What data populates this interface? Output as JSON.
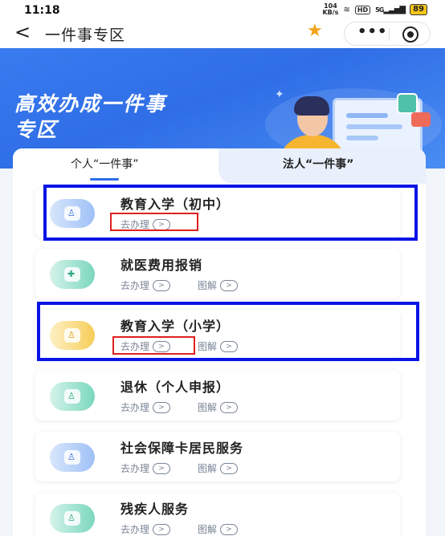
{
  "status_bar": {
    "time": "11:18",
    "net_speed_top": "104",
    "net_speed_bottom": "KB/s",
    "signal": "5G",
    "battery": "89"
  },
  "nav": {
    "back_glyph": "<",
    "title": "一件事专区",
    "more_glyph": "•••"
  },
  "banner": {
    "title_line1": "高效办成一件事",
    "title_line2": "专区"
  },
  "tabs": [
    {
      "label": "个人“一件事”",
      "active": true
    },
    {
      "label": "法人“一件事”",
      "active": false
    }
  ],
  "items": [
    {
      "name": "教育入学（初中）",
      "action": "去办理",
      "icon": "education-icon",
      "icon_color": "blue",
      "highlighted": true
    },
    {
      "name": "就医费用报销",
      "action": "去办理",
      "diagram": "图解",
      "icon": "medical-icon",
      "icon_color": "green"
    },
    {
      "name": "教育入学（小学）",
      "action": "去办理",
      "diagram": "图解",
      "icon": "education-icon",
      "icon_color": "yellow",
      "highlighted": true
    },
    {
      "name": "退休（个人申报）",
      "action": "去办理",
      "diagram": "图解",
      "icon": "retirement-icon",
      "icon_color": "green"
    },
    {
      "name": "社会保障卡居民服务",
      "action": "去办理",
      "diagram": "图解",
      "icon": "social-security-card-icon",
      "icon_color": "blue"
    },
    {
      "name": "残疾人服务",
      "action": "去办理",
      "diagram": "图解",
      "icon": "disability-service-icon",
      "icon_color": "green"
    }
  ],
  "colors": {
    "accent": "#2f6ee6",
    "annotation_blue": "#0a14e6",
    "annotation_red": "#e02020",
    "star": "#f2a41a"
  }
}
